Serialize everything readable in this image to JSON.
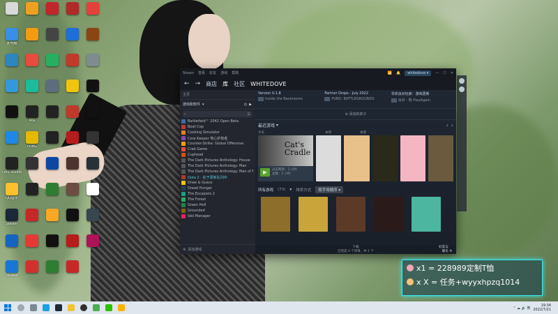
{
  "desktop_icons": [
    {
      "label": "",
      "color": "#d9d9d9"
    },
    {
      "label": "",
      "color": "#f0a020"
    },
    {
      "label": "",
      "color": "#c0262c"
    },
    {
      "label": "",
      "color": "#b02a2a"
    },
    {
      "label": "",
      "color": "#e6403a"
    },
    {
      "label": "此电脑",
      "color": "#3a8ee6"
    },
    {
      "label": "",
      "color": "#f39c12"
    },
    {
      "label": "",
      "color": "#444"
    },
    {
      "label": "",
      "color": "#1e6fd9"
    },
    {
      "label": "",
      "color": "#8b4513"
    },
    {
      "label": "",
      "color": "#2e86c1"
    },
    {
      "label": "",
      "color": "#e74c3c"
    },
    {
      "label": "",
      "color": "#27ae60"
    },
    {
      "label": "",
      "color": "#c0392b"
    },
    {
      "label": "",
      "color": "#7f8c8d"
    },
    {
      "label": "",
      "color": "#3498db"
    },
    {
      "label": "",
      "color": "#1abc9c"
    },
    {
      "label": "",
      "color": "#5d6d7e"
    },
    {
      "label": "",
      "color": "#f1c40f"
    },
    {
      "label": "",
      "color": "#111"
    },
    {
      "label": "",
      "color": "#111"
    },
    {
      "label": "MSI",
      "color": "#222"
    },
    {
      "label": "",
      "color": "#222"
    },
    {
      "label": "",
      "color": "#c0392b"
    },
    {
      "label": "",
      "color": "#111"
    },
    {
      "label": "",
      "color": "#1e88e5"
    },
    {
      "label": "PUBG",
      "color": "#e6b800"
    },
    {
      "label": "",
      "color": "#222"
    },
    {
      "label": "",
      "color": "#b71c1c"
    },
    {
      "label": "",
      "color": "#333"
    },
    {
      "label": "OBS Studio",
      "color": "#222"
    },
    {
      "label": "",
      "color": "#333"
    },
    {
      "label": "",
      "color": "#0d47a1"
    },
    {
      "label": "",
      "color": "#4e342e"
    },
    {
      "label": "",
      "color": "#263238"
    },
    {
      "label": "QQ音乐",
      "color": "#fbc02d"
    },
    {
      "label": "",
      "color": "#222"
    },
    {
      "label": "",
      "color": "#2e7d32"
    },
    {
      "label": "",
      "color": "#6d4c41"
    },
    {
      "label": "",
      "color": "#fff"
    },
    {
      "label": "Steam",
      "color": "#1b2838"
    },
    {
      "label": "",
      "color": "#c62828"
    },
    {
      "label": "",
      "color": "#f9a825"
    },
    {
      "label": "",
      "color": "#111"
    },
    {
      "label": "",
      "color": "#37474f"
    },
    {
      "label": "",
      "color": "#1565c0"
    },
    {
      "label": "",
      "color": "#e53935"
    },
    {
      "label": "",
      "color": "#111"
    },
    {
      "label": "",
      "color": "#b71c1c"
    },
    {
      "label": "",
      "color": "#ad1457"
    },
    {
      "label": "ToDesk",
      "color": "#1976d2"
    },
    {
      "label": "",
      "color": "#d32f2f"
    },
    {
      "label": "",
      "color": "#2e7d32"
    },
    {
      "label": "",
      "color": "#c62828"
    }
  ],
  "steam": {
    "titlebar": {
      "menu": [
        "Steam",
        "查看",
        "好友",
        "游戏",
        "帮助"
      ],
      "username": "whitedove"
    },
    "nav": {
      "tabs": [
        "商店",
        "库",
        "社区"
      ],
      "active": "库",
      "user_title": "WHITEDOVE"
    },
    "sidebar": {
      "home": "主页",
      "filter": "游戏和软件",
      "games": [
        {
          "name": "Battlefield™ 2042 Open Beta",
          "color": "#3b6ea5",
          "updating": false
        },
        {
          "name": "Beat Cop",
          "color": "#c0392b",
          "updating": false
        },
        {
          "name": "Cooking Simulator",
          "color": "#e67e22",
          "updating": false
        },
        {
          "name": "Core Keeper 地心护核者",
          "color": "#8e44ad",
          "updating": false
        },
        {
          "name": "Counter-Strike: Global Offensive",
          "color": "#f39c12",
          "updating": false
        },
        {
          "name": "Crab Game",
          "color": "#e74c3c",
          "updating": false
        },
        {
          "name": "Cuphead",
          "color": "#d35400",
          "updating": false
        },
        {
          "name": "The Dark Pictures Anthology: House",
          "color": "#555",
          "updating": false
        },
        {
          "name": "The Dark Pictures Anthology: Man",
          "color": "#555",
          "updating": false
        },
        {
          "name": "The Dark Pictures Anthology: Man of Medan",
          "color": "#555",
          "updating": false
        },
        {
          "name": "Dota 2 - 处于更新队列中",
          "color": "#b03a2e",
          "updating": true
        },
        {
          "name": "Draw & Guess",
          "color": "#f1c40f",
          "updating": false
        },
        {
          "name": "Dread Hunger",
          "color": "#2c3e50",
          "updating": false
        },
        {
          "name": "The Escapists 2",
          "color": "#16a085",
          "updating": false
        },
        {
          "name": "The Forest",
          "color": "#27ae60",
          "updating": false
        },
        {
          "name": "Green Hell",
          "color": "#1e8449",
          "updating": false
        },
        {
          "name": "Grounded",
          "color": "#7d6608",
          "updating": false
        },
        {
          "name": "Idol Manager",
          "color": "#e91e63",
          "updating": false
        }
      ],
      "add_game": "添加游戏"
    },
    "news": [
      {
        "title": "Version 0.1.8",
        "sub": "Inside the Backrooms"
      },
      {
        "title": "Partner Drops - July 2022",
        "sub": "PUBG: BATTLEGROUNDS"
      },
      {
        "title": "寻欢派对玩家：游戏更新",
        "sub": "派对 - 随 PlayAgain"
      }
    ],
    "add_shelf": "添加新架子",
    "recent": {
      "label": "最近游戏",
      "sub_headers": [
        "今天",
        "本周",
        "本周"
      ],
      "featured": {
        "title_line1": "Cat's",
        "title_line2": "Cradle",
        "time_line1": "过去两周：2 小时",
        "time_line2": "总数：2 小时"
      },
      "captions": [
        {
          "color": "#dcdcdc"
        },
        {
          "color": "#e8c08a"
        },
        {
          "color": "#2a2a1a"
        },
        {
          "color": "#f4b6c2"
        },
        {
          "color": "#6b5a3e"
        }
      ]
    },
    "all_games": {
      "label": "所有游戏",
      "count": "(73)",
      "sort_label": "排序方式",
      "sort_value": "按字母顺序",
      "captions": [
        {
          "color": "#8d6e2a"
        },
        {
          "color": "#c9a43a"
        },
        {
          "color": "#5c3a28"
        },
        {
          "color": "#2a1a1a"
        },
        {
          "color": "#4cb6a0"
        }
      ]
    },
    "status": {
      "download_line1": "下载",
      "download_line2": "已完成 0 个项目，共 1 个",
      "friends_line1": "好友与",
      "friends_line2": "聊天"
    }
  },
  "overlay": {
    "line1": "x1 = 228989定制T恤",
    "line2": "x X = 任务+wyyxhpzq1014"
  },
  "taskbar": {
    "time": "19:34",
    "date": "2022/7/21"
  }
}
